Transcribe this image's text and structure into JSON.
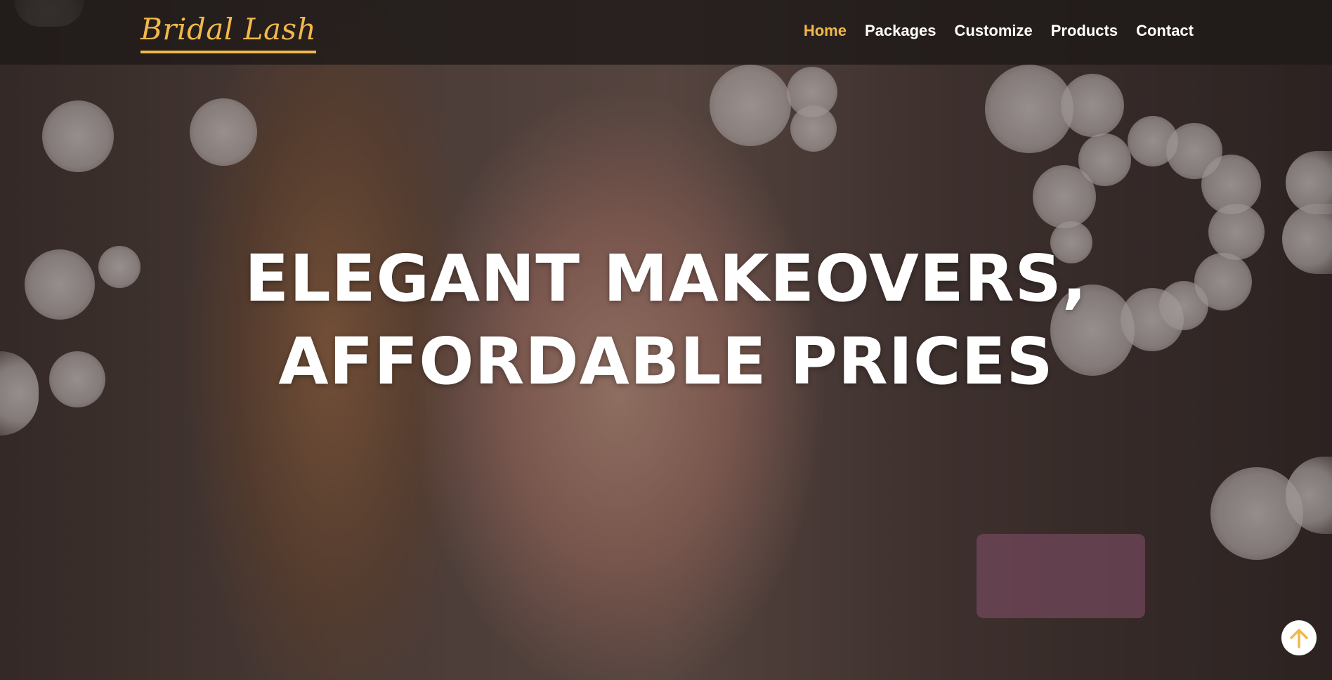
{
  "brand": {
    "logo_text": "Bridal Lash",
    "accent_color": "#f1b84a"
  },
  "nav": {
    "items": [
      {
        "label": "Home",
        "active": true
      },
      {
        "label": "Packages",
        "active": false
      },
      {
        "label": "Customize",
        "active": false
      },
      {
        "label": "Products",
        "active": false
      },
      {
        "label": "Contact",
        "active": false
      }
    ]
  },
  "hero": {
    "headline_line1": "ELEGANT MAKEOVERS,",
    "headline_line2": "AFFORDABLE PRICES",
    "background_image": "woman applying eyeshadow with brush, bokeh vanity lights"
  },
  "scroll_top": {
    "icon": "arrow-up-icon"
  }
}
